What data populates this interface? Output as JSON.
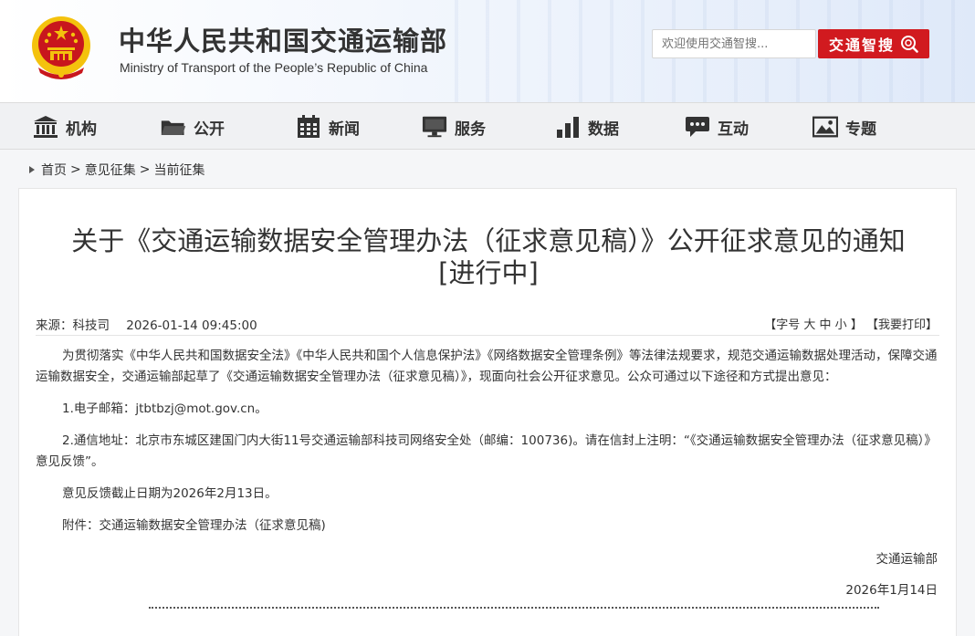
{
  "header": {
    "title": "中华人民共和国交通运输部",
    "subtitle": "Ministry of Transport of the People’s Republic of China",
    "search_placeholder": "欢迎使用交通智搜...",
    "search_button": "交通智搜"
  },
  "nav": {
    "items": [
      {
        "label": "机构",
        "icon": "building-icon"
      },
      {
        "label": "公开",
        "icon": "folder-icon"
      },
      {
        "label": "新闻",
        "icon": "calendar-icon"
      },
      {
        "label": "服务",
        "icon": "monitor-icon"
      },
      {
        "label": "数据",
        "icon": "bar-chart-icon"
      },
      {
        "label": "互动",
        "icon": "chat-bubble-icon"
      },
      {
        "label": "专题",
        "icon": "picture-icon"
      }
    ]
  },
  "breadcrumb": {
    "home": "首页",
    "section": "意见征集",
    "current": "当前征集",
    "separator": ">"
  },
  "article": {
    "title_line1": "关于《交通运输数据安全管理办法（征求意见稿）》公开征求意见的通知",
    "title_line2": "[进行中]",
    "source": "来源：科技司",
    "datetime": "2026-01-14 09:45:00",
    "tools": {
      "font_open": "【字号",
      "font_large": "大",
      "font_medium": "中",
      "font_small": "小",
      "font_close": "】",
      "print": "【我要打印】"
    },
    "paragraphs": [
      "为贯彻落实《中华人民共和国数据安全法》《中华人民共和国个人信息保护法》《网络数据安全管理条例》等法律法规要求，规范交通运输数据处理活动，保障交通运输数据安全，交通运输部起草了《交通运输数据安全管理办法（征求意见稿）》，现面向社会公开征求意见。公众可通过以下途径和方式提出意见：",
      "1.电子邮箱：jtbtbzj@mot.gov.cn。",
      "2.通信地址：北京市东城区建国门内大街11号交通运输部科技司网络安全处（邮编：100736)。请在信封上注明：“《交通运输数据安全管理办法（征求意见稿）》意见反馈”。",
      "意见反馈截止日期为2026年2月13日。",
      "附件：交通运输数据安全管理办法（征求意见稿)"
    ],
    "signature_dept": "交通运输部",
    "signature_date": "2026年1月14日"
  },
  "colors": {
    "accent_red": "#d11a1f",
    "emblem_red": "#c8161d",
    "emblem_gold": "#f4c20d"
  }
}
